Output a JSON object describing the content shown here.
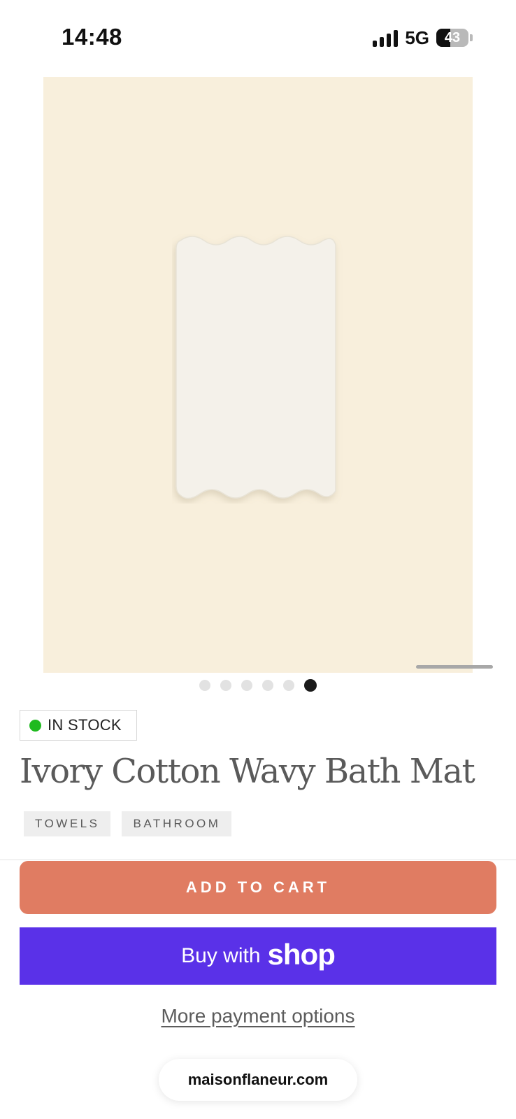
{
  "status_bar": {
    "time": "14:48",
    "network": "5G",
    "battery_level": "43",
    "icons": [
      "signal-icon",
      "battery-icon"
    ]
  },
  "product": {
    "image_name": "ivory-wavy-bath-mat-photo",
    "image_background": "#f8efdc",
    "carousel": {
      "total": 6,
      "active_index": 5
    },
    "stock_status": "IN STOCK",
    "stock_color": "#1fba1f",
    "title": "Ivory Cotton Wavy Bath Mat",
    "tags": [
      "TOWELS",
      "BATHROOM"
    ]
  },
  "actions": {
    "add_to_cart": "ADD TO CART",
    "add_to_cart_color": "#e07c62",
    "shop_pay_prefix": "Buy with",
    "shop_pay_brand": "shop",
    "shop_pay_color": "#5a31e8",
    "more_payment_options": "More payment options"
  },
  "browser": {
    "url": "maisonflaneur.com"
  }
}
